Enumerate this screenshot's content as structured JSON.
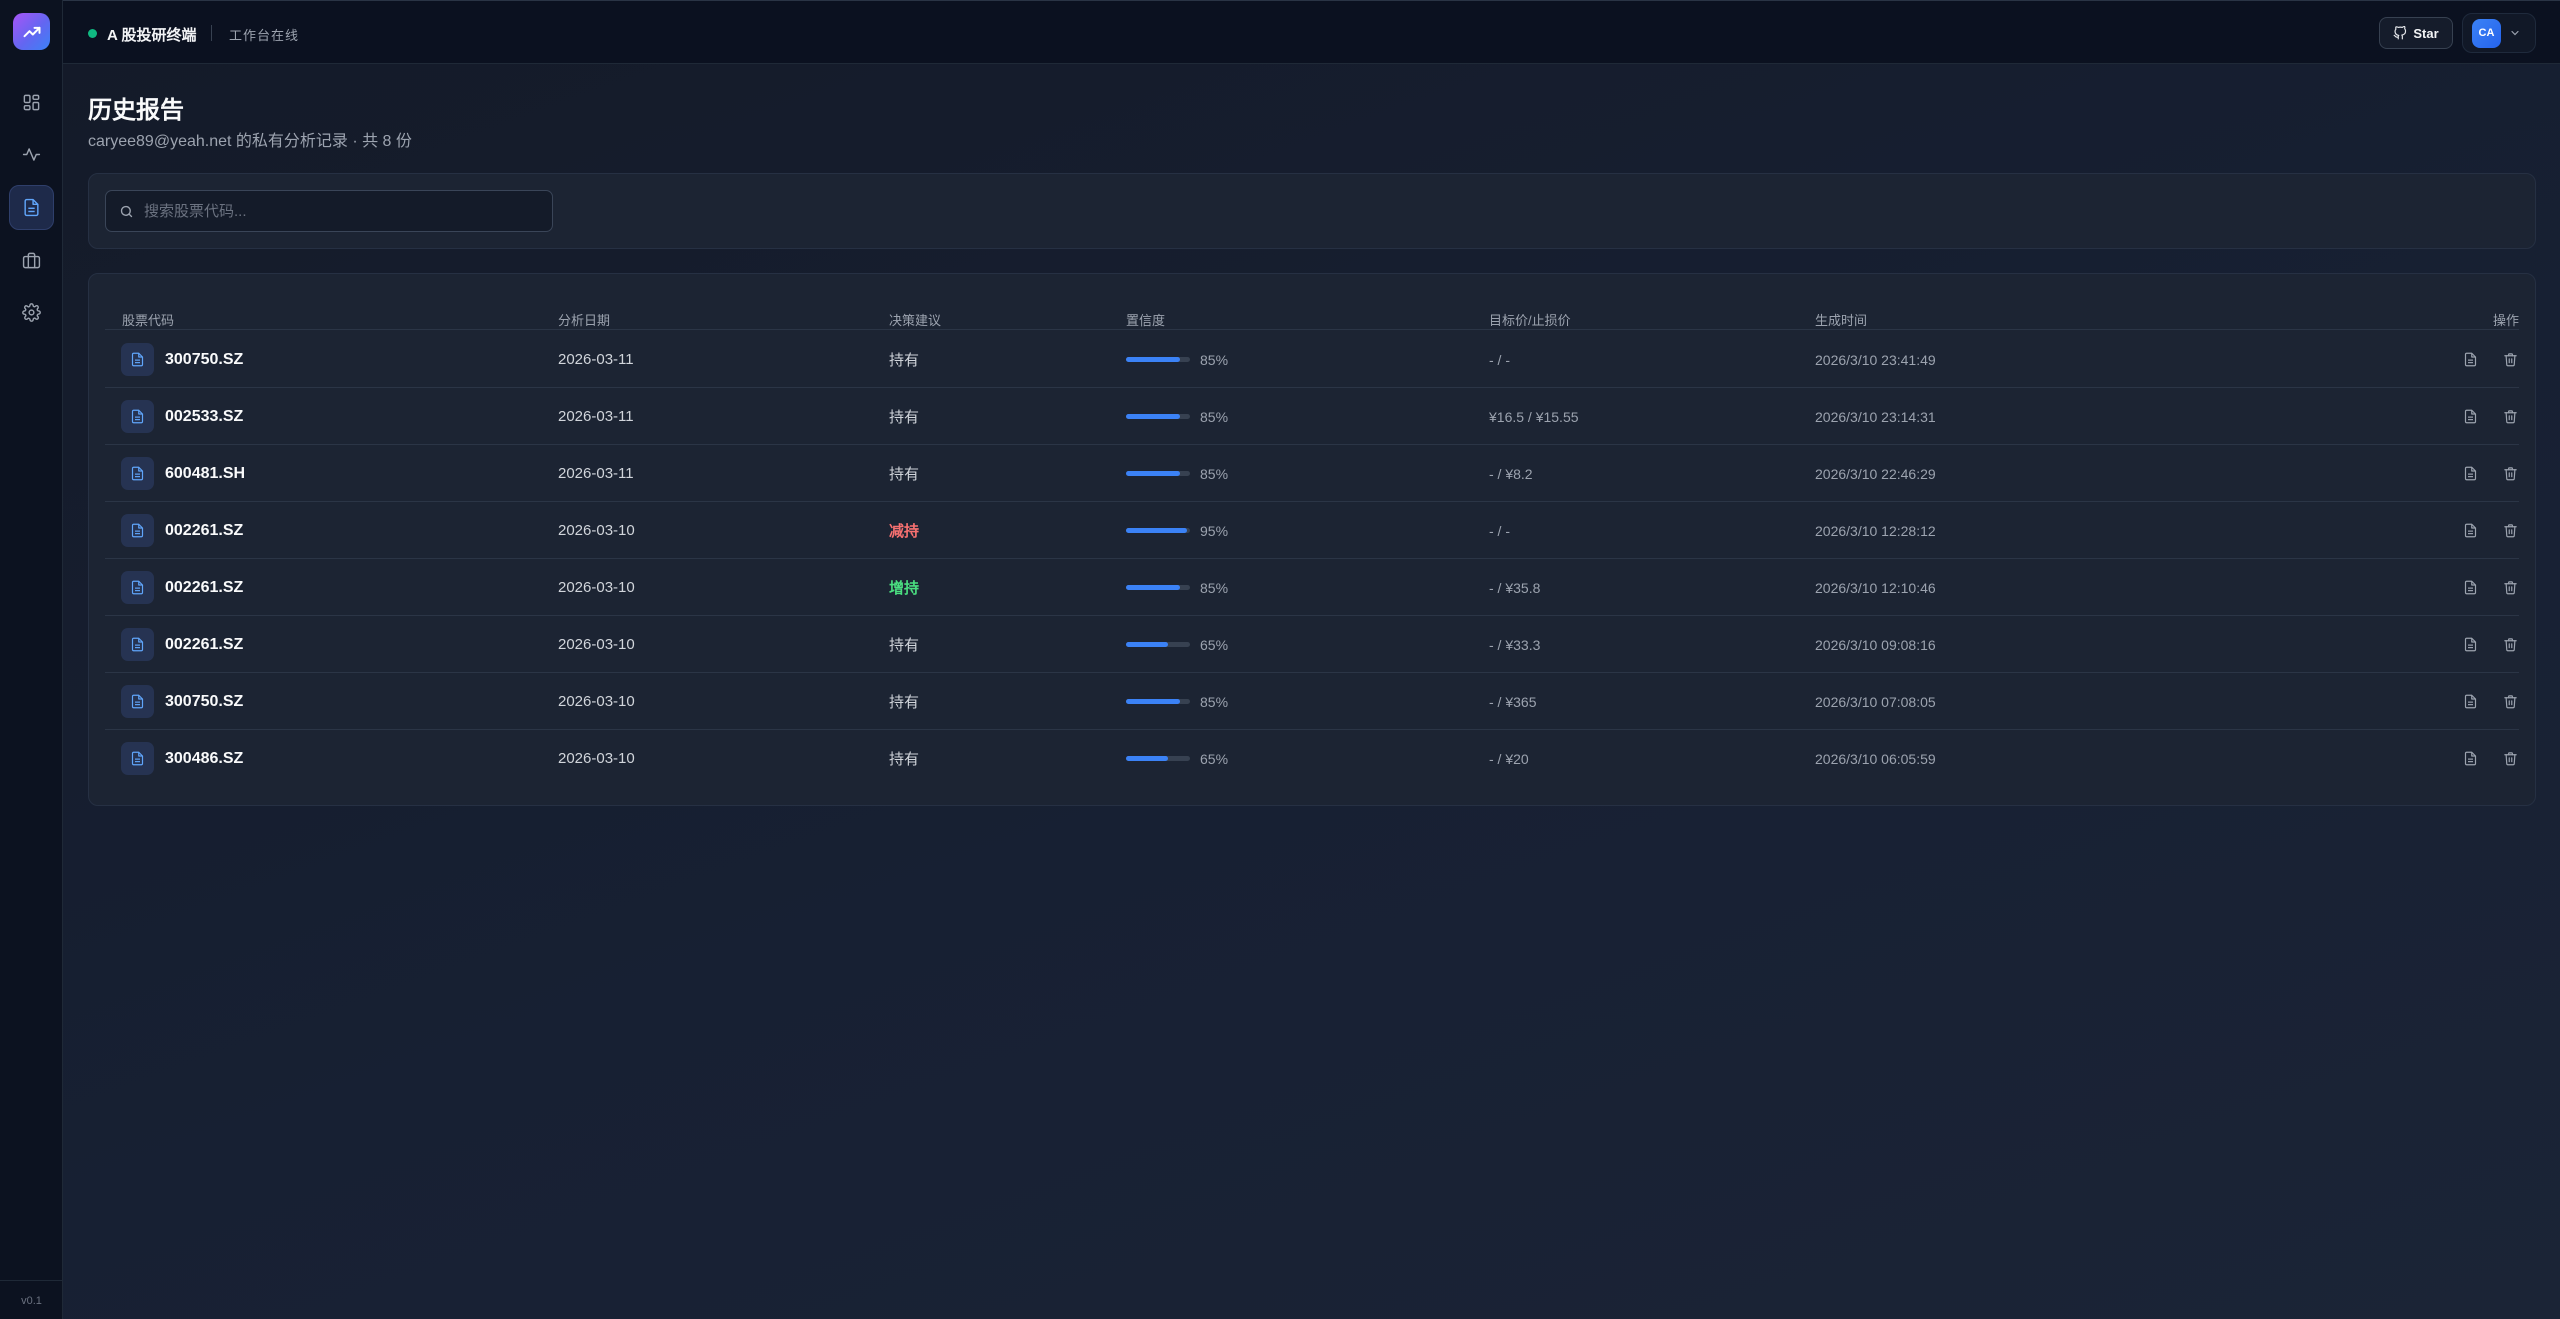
{
  "app": {
    "title": "A 股投研终端",
    "status": "工作台在线",
    "version": "v0.1",
    "accent": "#3b82f6",
    "status_color": "#10b981"
  },
  "sidebar": {
    "items": [
      {
        "icon": "dashboard-icon",
        "active": false
      },
      {
        "icon": "activity-icon",
        "active": false
      },
      {
        "icon": "report-icon",
        "active": true
      },
      {
        "icon": "briefcase-icon",
        "active": false
      },
      {
        "icon": "settings-icon",
        "active": false
      }
    ]
  },
  "topbar": {
    "star_label": "Star",
    "user_initials": "CA"
  },
  "page": {
    "title": "历史报告",
    "subtitle": "caryee89@yeah.net 的私有分析记录 · 共 8 份"
  },
  "search": {
    "placeholder": "搜索股票代码...",
    "value": ""
  },
  "table": {
    "headers": {
      "code": "股票代码",
      "date": "分析日期",
      "decision": "决策建议",
      "confidence": "置信度",
      "target": "目标价/止损价",
      "created": "生成时间",
      "actions": "操作"
    },
    "rows": [
      {
        "code": "300750.SZ",
        "date": "2026-03-11",
        "decision": "持有",
        "decision_type": "hold",
        "confidence": 85,
        "confidence_label": "85%",
        "target": "- / -",
        "created": "2026/3/10 23:41:49"
      },
      {
        "code": "002533.SZ",
        "date": "2026-03-11",
        "decision": "持有",
        "decision_type": "hold",
        "confidence": 85,
        "confidence_label": "85%",
        "target": "¥16.5 / ¥15.55",
        "created": "2026/3/10 23:14:31"
      },
      {
        "code": "600481.SH",
        "date": "2026-03-11",
        "decision": "持有",
        "decision_type": "hold",
        "confidence": 85,
        "confidence_label": "85%",
        "target": "- / ¥8.2",
        "created": "2026/3/10 22:46:29"
      },
      {
        "code": "002261.SZ",
        "date": "2026-03-10",
        "decision": "减持",
        "decision_type": "sell",
        "confidence": 95,
        "confidence_label": "95%",
        "target": "- / -",
        "created": "2026/3/10 12:28:12"
      },
      {
        "code": "002261.SZ",
        "date": "2026-03-10",
        "decision": "增持",
        "decision_type": "buy",
        "confidence": 85,
        "confidence_label": "85%",
        "target": "- / ¥35.8",
        "created": "2026/3/10 12:10:46"
      },
      {
        "code": "002261.SZ",
        "date": "2026-03-10",
        "decision": "持有",
        "decision_type": "hold",
        "confidence": 65,
        "confidence_label": "65%",
        "target": "- / ¥33.3",
        "created": "2026/3/10 09:08:16"
      },
      {
        "code": "300750.SZ",
        "date": "2026-03-10",
        "decision": "持有",
        "decision_type": "hold",
        "confidence": 85,
        "confidence_label": "85%",
        "target": "- / ¥365",
        "created": "2026/3/10 07:08:05"
      },
      {
        "code": "300486.SZ",
        "date": "2026-03-10",
        "decision": "持有",
        "decision_type": "hold",
        "confidence": 65,
        "confidence_label": "65%",
        "target": "- / ¥20",
        "created": "2026/3/10 06:05:59"
      }
    ]
  }
}
